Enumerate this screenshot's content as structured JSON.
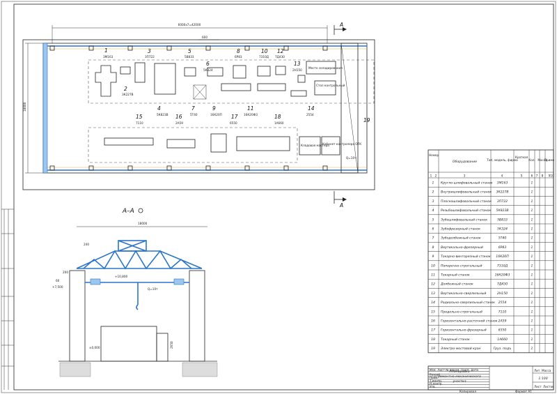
{
  "plan": {
    "dim_total": "6000х7=42000",
    "dim_600": "600",
    "dim_width": "18000",
    "section_mark": "A",
    "machines": [
      {
        "n": "1",
        "model": "3М163"
      },
      {
        "n": "2",
        "model": "3К227В"
      },
      {
        "n": "3",
        "model": "3П722"
      },
      {
        "n": "4",
        "model": "5К823В"
      },
      {
        "n": "5",
        "model": "5В833"
      },
      {
        "n": "6",
        "model": "5К324"
      },
      {
        "n": "7",
        "model": "5Т40"
      },
      {
        "n": "8",
        "model": "6Р83"
      },
      {
        "n": "9",
        "model": "16К20П"
      },
      {
        "n": "10",
        "model": "7310Д"
      },
      {
        "n": "11",
        "model": "16К20Ф3"
      },
      {
        "n": "12",
        "model": "7Д430"
      },
      {
        "n": "13",
        "model": "2Н150"
      },
      {
        "n": "14",
        "model": "2554"
      },
      {
        "n": "15",
        "model": "7110"
      },
      {
        "n": "16",
        "model": "2А59"
      },
      {
        "n": "17",
        "model": "6550"
      },
      {
        "n": "18",
        "model": "1А660"
      },
      {
        "n": "19",
        "model": "Q=10т"
      }
    ],
    "room_labels": {
      "master": "Место складирования",
      "otk": "Стол контрольный",
      "store": "Кладовая мастера",
      "office": "Кабинет контролера ОТК"
    }
  },
  "section": {
    "title": "А–А",
    "dims": {
      "span": "18000",
      "d240": "240",
      "d200": "200",
      "d60": "60",
      "d7500": "+7,500",
      "d10800": "+10,800",
      "load": "Q=10т",
      "d2650": "2650",
      "d0000": "±0,000"
    }
  },
  "table": {
    "headers": [
      "Номер",
      "Оборудование",
      "Тип, модель, фирма",
      "Краткая техническая характеристика",
      "Кол.",
      "Масса ед. кг",
      "Примечание"
    ],
    "colnums": [
      "1",
      "2",
      "3",
      "4",
      "5",
      "6",
      "7",
      "8",
      "9",
      "10"
    ],
    "rows": [
      {
        "n": "1",
        "name": "Кругло-шлифовальный станок",
        "model": "3М163",
        "qty": "1"
      },
      {
        "n": "2",
        "name": "Внутришлифовальный станок",
        "model": "3К227В",
        "qty": "1"
      },
      {
        "n": "3",
        "name": "Плоскошлифовальный станок",
        "model": "3П722",
        "qty": "1"
      },
      {
        "n": "4",
        "name": "Резьбошлифовальный станок",
        "model": "5К823В",
        "qty": "1"
      },
      {
        "n": "5",
        "name": "Зубошлифовальный станок",
        "model": "5В833",
        "qty": "1"
      },
      {
        "n": "6",
        "name": "Зубофрезерный станок",
        "model": "5К324",
        "qty": "1"
      },
      {
        "n": "7",
        "name": "Зубодолбежный станок",
        "model": "5Т40",
        "qty": "1"
      },
      {
        "n": "8",
        "name": "Вертикально-фрезерный",
        "model": "6Р83",
        "qty": "1"
      },
      {
        "n": "9",
        "name": "Токарно-винторезный станок",
        "model": "16К20П",
        "qty": "1"
      },
      {
        "n": "10",
        "name": "Поперечно-строгальный",
        "model": "7310Д",
        "qty": "1"
      },
      {
        "n": "11",
        "name": "Токарный станок",
        "model": "16К20Ф3",
        "qty": "1"
      },
      {
        "n": "12",
        "name": "Долбежный станок",
        "model": "7Д430",
        "qty": "1"
      },
      {
        "n": "13",
        "name": "Вертикально-сверлильный",
        "model": "2Н150",
        "qty": "1"
      },
      {
        "n": "14",
        "name": "Радиально-сверлильный станок",
        "model": "2554",
        "qty": "1"
      },
      {
        "n": "15",
        "name": "Продольно-строгальный",
        "model": "7110",
        "qty": "1"
      },
      {
        "n": "16",
        "name": "Горизонтально-расточной станок",
        "model": "2А59",
        "qty": "1"
      },
      {
        "n": "17",
        "name": "Горизонтально-фрезерный",
        "model": "6550",
        "qty": "1"
      },
      {
        "n": "18",
        "name": "Токарный станок",
        "model": "1А660",
        "qty": "1"
      },
      {
        "n": "19",
        "name": "Электро-мостовой кран",
        "model": "Груз. подъёмность 10 т",
        "qty": "1"
      }
    ]
  },
  "titleblock": {
    "title_line1": "Планировка",
    "title_line2": "ремонтно-механического",
    "title_line3": "участка",
    "scale": "1:100",
    "sheet": "Лист",
    "sheets": "Листов",
    "lit": "Лит.",
    "mass": "Масса",
    "scale_label": "Масштаб",
    "rows": [
      "Изм. Лист",
      "№ докум.",
      "Подп.",
      "Дата",
      "Разраб.",
      "Пров.",
      "Т.контр.",
      "Н.контр.",
      "Утв."
    ]
  },
  "footer": {
    "copy": "Копировал",
    "format": "Формат А1"
  }
}
